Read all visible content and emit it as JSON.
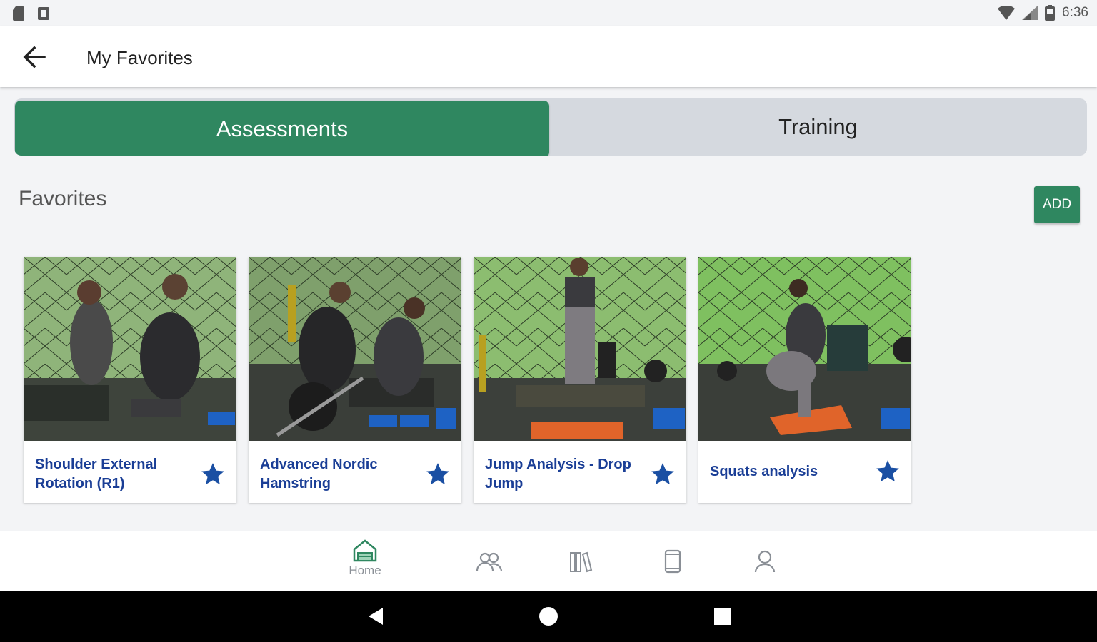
{
  "status_bar": {
    "time": "6:36"
  },
  "app_bar": {
    "title": "My Favorites"
  },
  "tabs": [
    {
      "label": "Assessments",
      "active": true
    },
    {
      "label": "Training",
      "active": false
    }
  ],
  "section": {
    "title": "Favorites",
    "add_label": "ADD"
  },
  "cards": [
    {
      "title": "Shoulder External Rotation (R1)",
      "favorited": true
    },
    {
      "title": "Advanced Nordic Hamstring",
      "favorited": true
    },
    {
      "title": "Jump Analysis - Drop Jump",
      "favorited": true
    },
    {
      "title": "Squats analysis",
      "favorited": true
    }
  ],
  "bottom_nav": [
    {
      "icon": "home-icon",
      "label": "Home",
      "active": true
    },
    {
      "icon": "users-icon",
      "label": "",
      "active": false
    },
    {
      "icon": "library-icon",
      "label": "",
      "active": false
    },
    {
      "icon": "device-icon",
      "label": "",
      "active": false
    },
    {
      "icon": "profile-icon",
      "label": "",
      "active": false
    }
  ],
  "colors": {
    "accent": "#2f8760",
    "card_title": "#1a3e96",
    "star": "#1a4fa3",
    "background": "#f3f4f6"
  }
}
